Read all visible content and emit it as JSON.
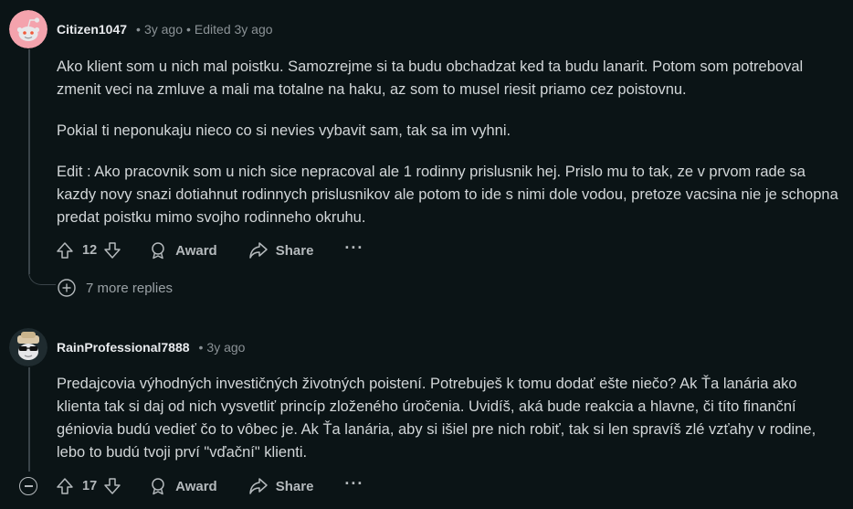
{
  "comments": [
    {
      "author": "Citizen1047",
      "age": "3y ago",
      "edited": "Edited 3y ago",
      "paragraphs": [
        "Ako klient som u nich mal poistku. Samozrejme si ta budu obchadzat ked ta budu lanarit. Potom som potreboval zmenit veci na zmluve a mali ma totalne na haku, az som to musel riesit priamo cez poistovnu.",
        "Pokial ti neponukaju nieco co si nevies vybavit sam, tak sa im vyhni.",
        "Edit : Ako pracovnik som u nich sice nepracoval ale 1 rodinny prislusnik hej. Prislo mu to tak, ze v prvom rade sa kazdy novy snazi dotiahnut rodinnych prislusnikov ale potom to ide s nimi dole vodou, pretoze vacsina nie je schopna predat poistku mimo svojho rodinneho okruhu."
      ],
      "votes": "12",
      "award_label": "Award",
      "share_label": "Share",
      "more_label": "···",
      "more_replies": "7 more replies",
      "avatar_icon": "snoo-avatar-pink"
    },
    {
      "author": "RainProfessional7888",
      "age": "3y ago",
      "paragraphs": [
        "Predajcovia výhodných investičných životných poistení. Potrebuješ k tomu dodať ešte niečo? Ak Ťa lanária ako klienta tak si daj od nich vysvetliť princíp zloženého úročenia. Uvidíš, aká bude reakcia a hlavne, či títo finanční géniovia budú vedieť čo to vôbec je. Ak Ťa lanária, aby si išiel pre nich robiť, tak si len spravíš zlé vzťahy v rodine, lebo to budú tvoji prví \"vďační\" klienti."
      ],
      "votes": "17",
      "award_label": "Award",
      "share_label": "Share",
      "more_label": "···",
      "avatar_icon": "snoo-avatar-sunglasses"
    }
  ],
  "colors": {
    "background": "#0b1416",
    "text": "#d2d6d8",
    "meta": "#8b9296",
    "thread_line": "#3a4449"
  }
}
